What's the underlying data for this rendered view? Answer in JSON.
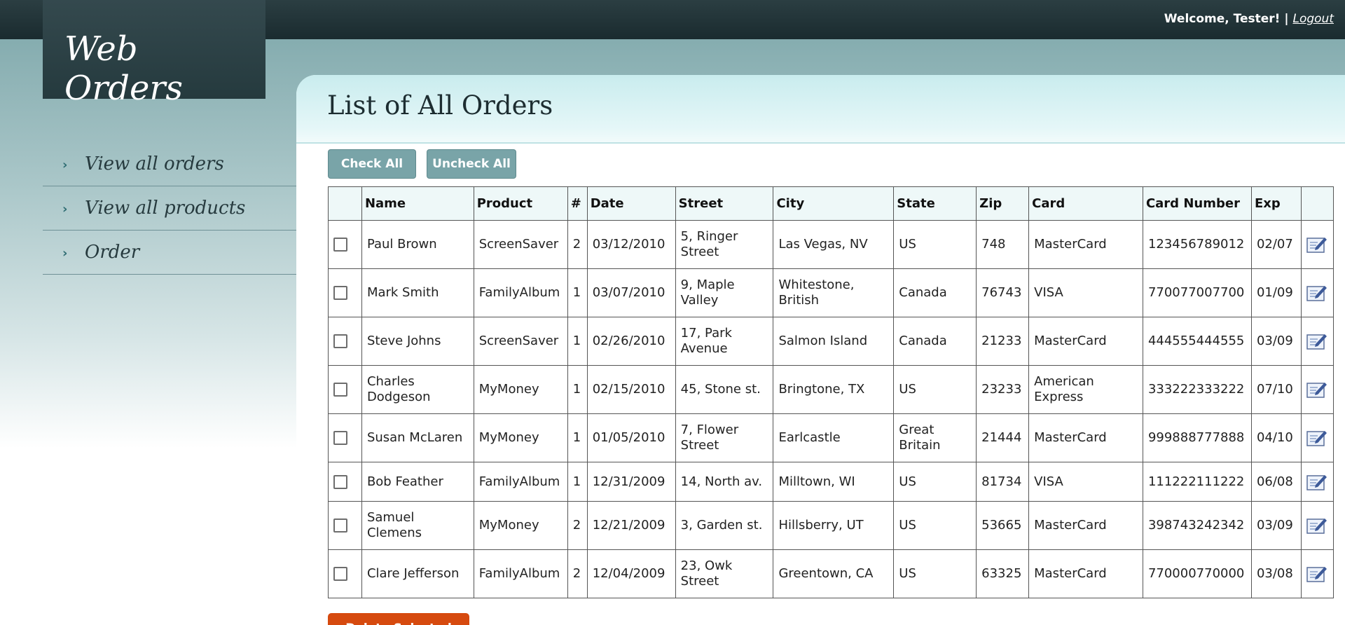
{
  "header": {
    "welcome_text": "Welcome, Tester! | ",
    "logout_label": "Logout",
    "logo_text": "Web Orders"
  },
  "sidebar": {
    "items": [
      {
        "label": "View all orders"
      },
      {
        "label": "View all products"
      },
      {
        "label": "Order"
      }
    ]
  },
  "main": {
    "title": "List of All Orders",
    "check_all_label": "Check All",
    "uncheck_all_label": "Uncheck All",
    "delete_label": "Delete Selected",
    "columns": [
      "Name",
      "Product",
      "#",
      "Date",
      "Street",
      "City",
      "State",
      "Zip",
      "Card",
      "Card Number",
      "Exp"
    ],
    "rows": [
      {
        "name": "Paul Brown",
        "product": "ScreenSaver",
        "qty": "2",
        "date": "03/12/2010",
        "street": "5, Ringer Street",
        "city": "Las Vegas, NV",
        "state": "US",
        "zip": "748",
        "card": "MasterCard",
        "card_number": "123456789012",
        "exp": "02/07"
      },
      {
        "name": "Mark Smith",
        "product": "FamilyAlbum",
        "qty": "1",
        "date": "03/07/2010",
        "street": "9, Maple Valley",
        "city": "Whitestone, British",
        "state": "Canada",
        "zip": "76743",
        "card": "VISA",
        "card_number": "770077007700",
        "exp": "01/09"
      },
      {
        "name": "Steve Johns",
        "product": "ScreenSaver",
        "qty": "1",
        "date": "02/26/2010",
        "street": "17, Park Avenue",
        "city": "Salmon Island",
        "state": "Canada",
        "zip": "21233",
        "card": "MasterCard",
        "card_number": "444555444555",
        "exp": "03/09"
      },
      {
        "name": "Charles Dodgeson",
        "product": "MyMoney",
        "qty": "1",
        "date": "02/15/2010",
        "street": "45, Stone st.",
        "city": "Bringtone, TX",
        "state": "US",
        "zip": "23233",
        "card": "American Express",
        "card_number": "333222333222",
        "exp": "07/10"
      },
      {
        "name": "Susan McLaren",
        "product": "MyMoney",
        "qty": "1",
        "date": "01/05/2010",
        "street": "7, Flower Street",
        "city": "Earlcastle",
        "state": "Great Britain",
        "zip": "21444",
        "card": "MasterCard",
        "card_number": "999888777888",
        "exp": "04/10"
      },
      {
        "name": "Bob Feather",
        "product": "FamilyAlbum",
        "qty": "1",
        "date": "12/31/2009",
        "street": "14, North av.",
        "city": "Milltown, WI",
        "state": "US",
        "zip": "81734",
        "card": "VISA",
        "card_number": "111222111222",
        "exp": "06/08"
      },
      {
        "name": "Samuel Clemens",
        "product": "MyMoney",
        "qty": "2",
        "date": "12/21/2009",
        "street": "3, Garden st.",
        "city": "Hillsberry, UT",
        "state": "US",
        "zip": "53665",
        "card": "MasterCard",
        "card_number": "398743242342",
        "exp": "03/09"
      },
      {
        "name": "Clare Jefferson",
        "product": "FamilyAlbum",
        "qty": "2",
        "date": "12/04/2009",
        "street": "23, Owk Street",
        "city": "Greentown, CA",
        "state": "US",
        "zip": "63325",
        "card": "MasterCard",
        "card_number": "770000770000",
        "exp": "03/08"
      }
    ]
  },
  "colors": {
    "topbar": "#1f3236",
    "accent_button": "#79a4a8",
    "delete_button": "#d64a0f"
  }
}
